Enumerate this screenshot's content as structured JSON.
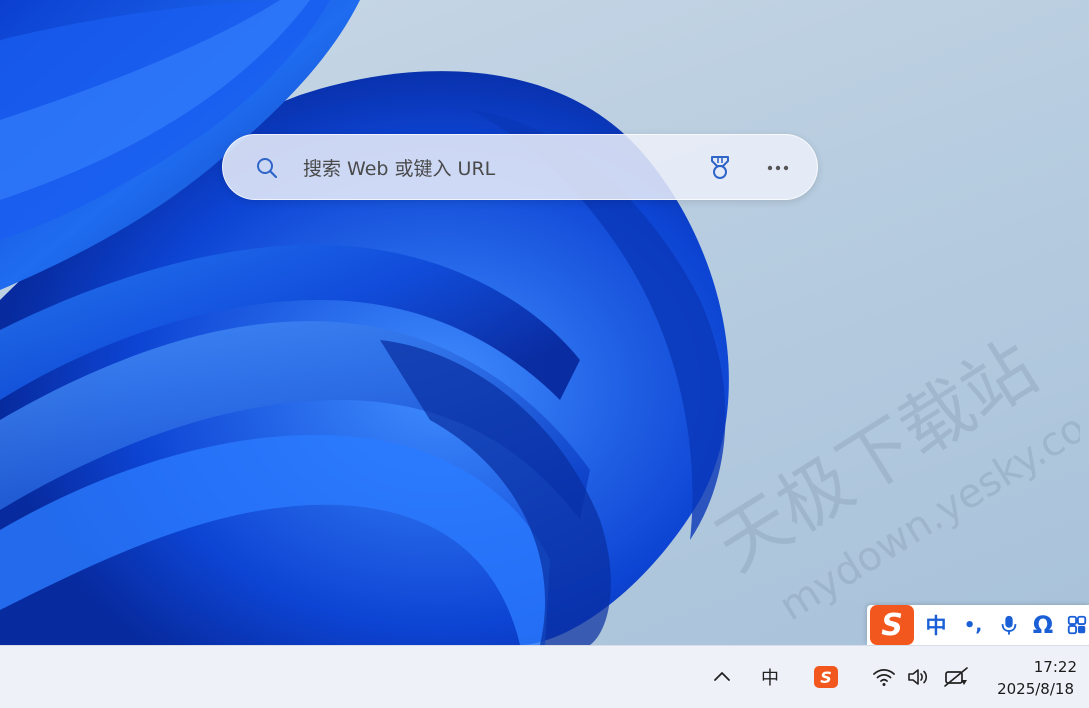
{
  "search": {
    "placeholder": "搜索 Web 或键入 URL",
    "value": ""
  },
  "icons": {
    "search": "search-icon",
    "rewards": "rewards-medal-icon",
    "more": "more-horizontal-icon",
    "overflow": "chevron-up-icon",
    "wifi": "wifi-icon",
    "volume": "speaker-icon",
    "network": "network-status-icon"
  },
  "ime_toolbar": {
    "logo": "S",
    "mode": "中",
    "punct": "•,",
    "symbol": "Ω"
  },
  "taskbar": {
    "ime_mode": "中",
    "sogou_logo": "S",
    "clock_time": "17:22",
    "clock_date": "2025/8/18"
  },
  "watermark": {
    "line1": "天极下载站",
    "line2": "mydown.yesky.com"
  },
  "colors": {
    "accent": "#1a5fd6",
    "sogou": "#f2581e",
    "taskbar": "#eef1f8"
  }
}
